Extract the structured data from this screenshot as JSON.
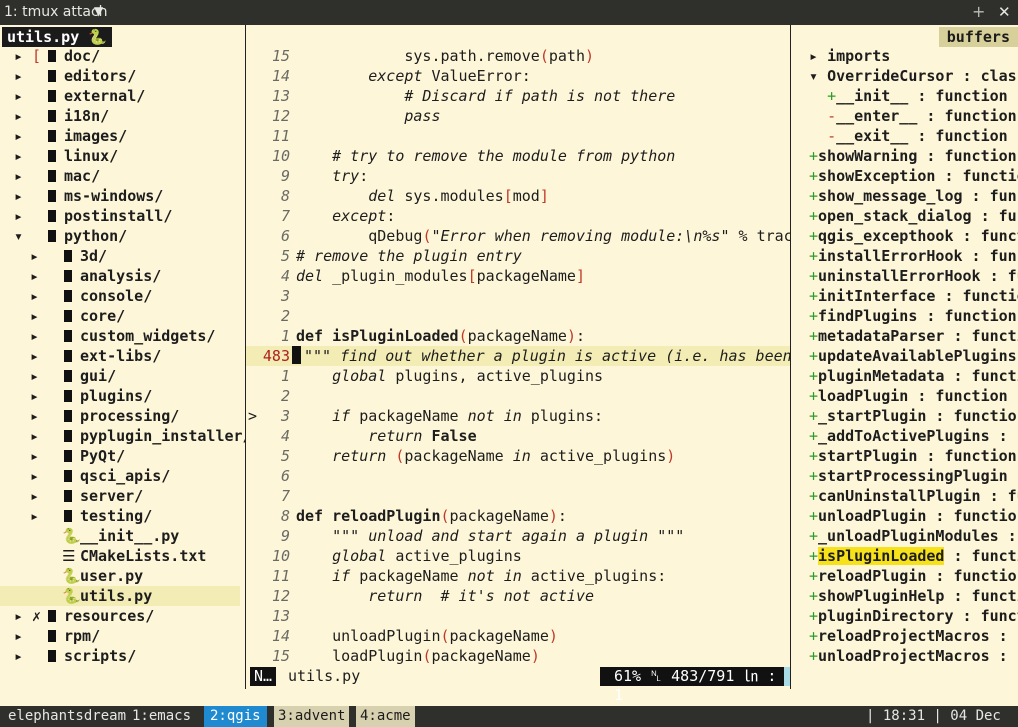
{
  "titlebar": {
    "title": "1: tmux attach",
    "dropdown": "▼",
    "plus": "+",
    "close": "✕"
  },
  "left": {
    "tab": "utils.py ",
    "tab_icon": "🐍",
    "tree": [
      {
        "arrow": "▸",
        "mark": "[",
        "indent": 0,
        "folder": true,
        "name": "doc/"
      },
      {
        "arrow": "▸",
        "indent": 0,
        "folder": true,
        "name": "editors/"
      },
      {
        "arrow": "▸",
        "indent": 0,
        "folder": true,
        "name": "external/"
      },
      {
        "arrow": "▸",
        "indent": 0,
        "folder": true,
        "name": "i18n/"
      },
      {
        "arrow": "▸",
        "indent": 0,
        "folder": true,
        "name": "images/"
      },
      {
        "arrow": "▸",
        "indent": 0,
        "folder": true,
        "name": "linux/"
      },
      {
        "arrow": "▸",
        "indent": 0,
        "folder": true,
        "name": "mac/"
      },
      {
        "arrow": "▸",
        "indent": 0,
        "folder": true,
        "name": "ms-windows/"
      },
      {
        "arrow": "▸",
        "indent": 0,
        "folder": true,
        "name": "postinstall/"
      },
      {
        "arrow": "▾",
        "indent": 0,
        "folder": true,
        "name": "python/"
      },
      {
        "arrow": "▸",
        "indent": 1,
        "folder": true,
        "name": "3d/"
      },
      {
        "arrow": "▸",
        "indent": 1,
        "folder": true,
        "name": "analysis/"
      },
      {
        "arrow": "▸",
        "indent": 1,
        "folder": true,
        "name": "console/"
      },
      {
        "arrow": "▸",
        "indent": 1,
        "folder": true,
        "name": "core/"
      },
      {
        "arrow": "▸",
        "indent": 1,
        "folder": true,
        "name": "custom_widgets/"
      },
      {
        "arrow": "▸",
        "indent": 1,
        "folder": true,
        "name": "ext-libs/"
      },
      {
        "arrow": "▸",
        "indent": 1,
        "folder": true,
        "name": "gui/"
      },
      {
        "arrow": "▸",
        "indent": 1,
        "folder": true,
        "name": "plugins/"
      },
      {
        "arrow": "▸",
        "indent": 1,
        "folder": true,
        "name": "processing/"
      },
      {
        "arrow": "▸",
        "indent": 1,
        "folder": true,
        "name": "pyplugin_installer/"
      },
      {
        "arrow": "▸",
        "indent": 1,
        "folder": true,
        "name": "PyQt/"
      },
      {
        "arrow": "▸",
        "indent": 1,
        "folder": true,
        "name": "qsci_apis/"
      },
      {
        "arrow": "▸",
        "indent": 1,
        "folder": true,
        "name": "server/"
      },
      {
        "arrow": "▸",
        "indent": 1,
        "folder": true,
        "name": "testing/"
      },
      {
        "arrow": "",
        "indent": 1,
        "icon": "🐍",
        "name": "__init__.py"
      },
      {
        "arrow": "",
        "indent": 1,
        "icon": "☰",
        "name": "CMakeLists.txt"
      },
      {
        "arrow": "",
        "indent": 1,
        "icon": "🐍",
        "name": "user.py"
      },
      {
        "arrow": "",
        "indent": 1,
        "icon": "🐍",
        "name": "utils.py",
        "selected": true
      },
      {
        "arrow": "▸",
        "mark": "✗",
        "indent": 0,
        "folder": true,
        "name": "resources/"
      },
      {
        "arrow": "▸",
        "indent": 0,
        "folder": true,
        "name": "rpm/"
      },
      {
        "arrow": "▸",
        "indent": 0,
        "folder": true,
        "name": "scripts/"
      }
    ]
  },
  "editor": {
    "lines": [
      {
        "n": "15",
        "html": "            sys.path.remove<span class=\"br\">(</span>path<span class=\"br\">)</span>"
      },
      {
        "n": "14",
        "html": "        <span class=\"kw\">except</span> ValueError:"
      },
      {
        "n": "13",
        "html": "            <span class=\"cm\"># Discard if path is not there</span>"
      },
      {
        "n": "12",
        "html": "            <span class=\"kw\">pass</span>"
      },
      {
        "n": "11",
        "html": ""
      },
      {
        "n": "10",
        "html": "    <span class=\"cm\"># try to remove the module from python</span>"
      },
      {
        "n": "9",
        "html": "    <span class=\"kw\">try</span>:"
      },
      {
        "n": "8",
        "html": "        <span class=\"kw\">del</span> sys.modules<span class=\"br\">[</span>mod<span class=\"br\">]</span>"
      },
      {
        "n": "7",
        "html": "    <span class=\"kw\">except</span>:"
      },
      {
        "n": "6",
        "html": "        qDebug<span class=\"br\">(</span><span class=\"cm\">\"Error when removing module:\\n%s\"</span> % trace"
      },
      {
        "n": "5",
        "html": "<span class=\"cm\"># remove the plugin entry</span>"
      },
      {
        "n": "4",
        "html": "<span class=\"kw\">del</span> _plugin_modules<span class=\"br\">[</span>packageName<span class=\"br\">]</span>"
      },
      {
        "n": "3",
        "html": ""
      },
      {
        "n": "2",
        "html": ""
      },
      {
        "n": "1",
        "html": "<b>def</b> <b>isPluginLoaded</b><span class=\"br\">(</span>packageName<span class=\"br\">)</span>:",
        "def": true
      },
      {
        "n": "483",
        "html": "<span class=\"cm\">\"\"\" find out whether a plugin is active (i.e. has been s</span>",
        "current": true
      },
      {
        "n": "1",
        "html": "    <span class=\"kw\">global</span> plugins, active_plugins"
      },
      {
        "n": "2",
        "html": ""
      },
      {
        "n": "3",
        "html": "    <span class=\"kw\">if</span> packageName <span class=\"kw\">not in</span> plugins:",
        "mark": ">"
      },
      {
        "n": "4",
        "html": "        <span class=\"kw\">return</span> <b>False</b>"
      },
      {
        "n": "5",
        "html": "    <span class=\"kw\">return</span> <span class=\"br\">(</span>packageName <span class=\"kw\">in</span> active_plugins<span class=\"br\">)</span>"
      },
      {
        "n": "6",
        "html": ""
      },
      {
        "n": "7",
        "html": ""
      },
      {
        "n": "8",
        "html": "<b>def</b> <b>reloadPlugin</b><span class=\"br\">(</span>packageName<span class=\"br\">)</span>:",
        "def": true
      },
      {
        "n": "9",
        "html": "    <span class=\"cm\">\"\"\" unload and start again a plugin \"\"\"</span>"
      },
      {
        "n": "10",
        "html": "    <span class=\"kw\">global</span> active_plugins"
      },
      {
        "n": "11",
        "html": "    <span class=\"kw\">if</span> packageName <span class=\"kw\">not in</span> active_plugins:"
      },
      {
        "n": "12",
        "html": "        <span class=\"kw\">return</span>  <span class=\"cm\"># it's not active</span>"
      },
      {
        "n": "13",
        "html": ""
      },
      {
        "n": "14",
        "html": "    unloadPlugin<span class=\"br\">(</span>packageName<span class=\"br\">)</span>"
      },
      {
        "n": "15",
        "html": "    loadPlugin<span class=\"br\">(</span>packageName<span class=\"br\">)</span>"
      }
    ]
  },
  "status": {
    "mode": "N…",
    "filename": "utils.py",
    "percent": "61%",
    "position": "483/791",
    "col": "1"
  },
  "right": {
    "tab": "buffers",
    "items": [
      {
        "pre": "▸ ",
        "name": "imports",
        "bold": true
      },
      {
        "pre": "▾ ",
        "name": "OverrideCursor : class",
        "bold": true
      },
      {
        "pre": "  ",
        "sign": "+",
        "name": "__init__ : function"
      },
      {
        "pre": "  ",
        "sign": "-",
        "name": "__enter__ : function"
      },
      {
        "pre": "  ",
        "sign": "-",
        "name": "__exit__ : function"
      },
      {
        "pre": "",
        "sign": "+",
        "name": "showWarning : function"
      },
      {
        "pre": "",
        "sign": "+",
        "name": "showException : function"
      },
      {
        "pre": "",
        "sign": "+",
        "name": "show_message_log : func"
      },
      {
        "pre": "",
        "sign": "+",
        "name": "open_stack_dialog : fun"
      },
      {
        "pre": "",
        "sign": "+",
        "name": "qgis_excepthook : funct"
      },
      {
        "pre": "",
        "sign": "+",
        "name": "installErrorHook : func"
      },
      {
        "pre": "",
        "sign": "+",
        "name": "uninstallErrorHook : fu"
      },
      {
        "pre": "",
        "sign": "+",
        "name": "initInterface : function"
      },
      {
        "pre": "",
        "sign": "+",
        "name": "findPlugins : function"
      },
      {
        "pre": "",
        "sign": "+",
        "name": "metadataParser : functi"
      },
      {
        "pre": "",
        "sign": "+",
        "name": "updateAvailablePlugins"
      },
      {
        "pre": "",
        "sign": "+",
        "name": "pluginMetadata : functi"
      },
      {
        "pre": "",
        "sign": "+",
        "name": "loadPlugin : function"
      },
      {
        "pre": "",
        "sign": "+",
        "name": "_startPlugin : function"
      },
      {
        "pre": "",
        "sign": "+",
        "name": "_addToActivePlugins : f"
      },
      {
        "pre": "",
        "sign": "+",
        "name": "startPlugin : function"
      },
      {
        "pre": "",
        "sign": "+",
        "name": "startProcessingPlugin :"
      },
      {
        "pre": "",
        "sign": "+",
        "name": "canUninstallPlugin : fu"
      },
      {
        "pre": "",
        "sign": "+",
        "name": "unloadPlugin : function"
      },
      {
        "pre": "",
        "sign": "+",
        "name": "_unloadPluginModules :"
      },
      {
        "pre": "",
        "sign": "+",
        "name": "isPluginLoaded",
        "rest": " : functi",
        "hl": true
      },
      {
        "pre": "",
        "sign": "+",
        "name": "reloadPlugin : function"
      },
      {
        "pre": "",
        "sign": "+",
        "name": "showPluginHelp : functi"
      },
      {
        "pre": "",
        "sign": "+",
        "name": "pluginDirectory : funct"
      },
      {
        "pre": "",
        "sign": "+",
        "name": "reloadProjectMacros : f"
      },
      {
        "pre": "",
        "sign": "+",
        "name": "unloadProjectMacros : f"
      }
    ]
  },
  "tmux": {
    "session": "elephantsdream",
    "windows": [
      {
        "label": "1:emacs",
        "active": false
      },
      {
        "label": "2:qgis",
        "active": true
      },
      {
        "label": "3:advent",
        "active": false,
        "boxed": true
      },
      {
        "label": "4:acme",
        "active": false,
        "boxed": true
      }
    ],
    "time": "| 18:31 | 04 Dec"
  }
}
